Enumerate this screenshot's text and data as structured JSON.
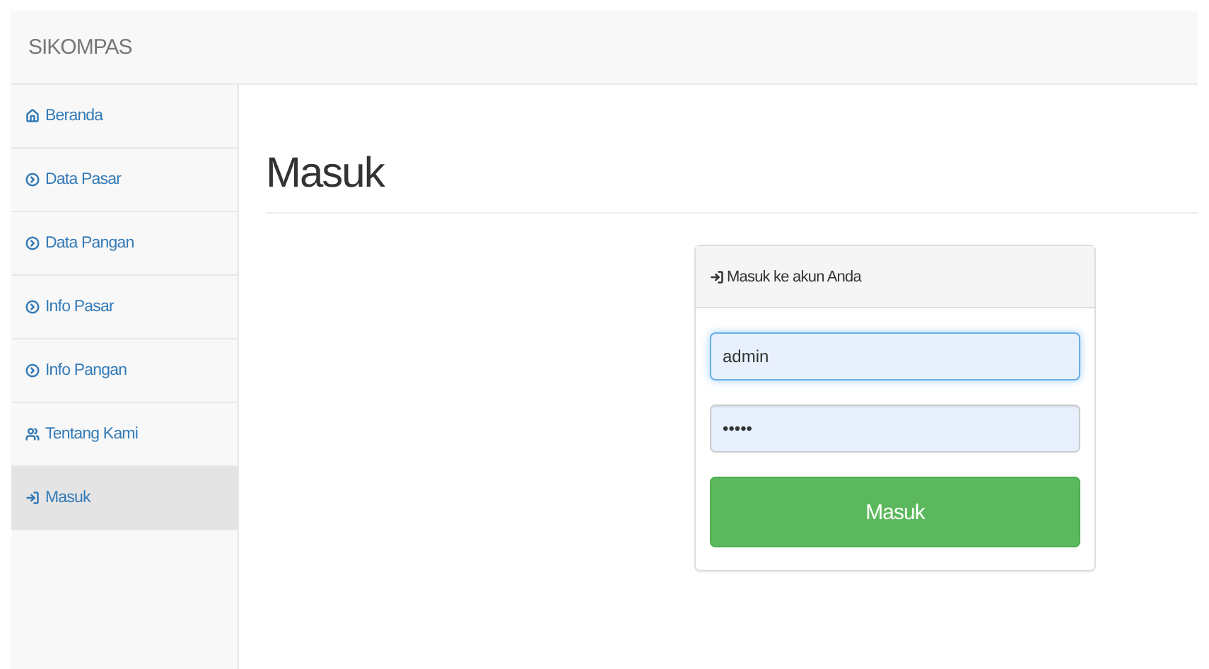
{
  "navbar": {
    "brand": "SIKOMPAS"
  },
  "sidebar": {
    "items": [
      {
        "label": "Beranda",
        "kind": "home",
        "selected": false
      },
      {
        "label": "Data Pasar",
        "kind": "circle",
        "selected": false
      },
      {
        "label": "Data Pangan",
        "kind": "circle",
        "selected": false
      },
      {
        "label": "Info Pasar",
        "kind": "circle",
        "selected": false
      },
      {
        "label": "Info Pangan",
        "kind": "circle",
        "selected": false
      },
      {
        "label": "Tentang Kami",
        "kind": "users",
        "selected": false
      },
      {
        "label": "Masuk",
        "kind": "login",
        "selected": true
      }
    ]
  },
  "page": {
    "title": "Masuk"
  },
  "login_panel": {
    "heading": "Masuk ke akun Anda",
    "username": {
      "value": "admin"
    },
    "password": {
      "value": "•••••"
    },
    "submit": "Masuk"
  }
}
